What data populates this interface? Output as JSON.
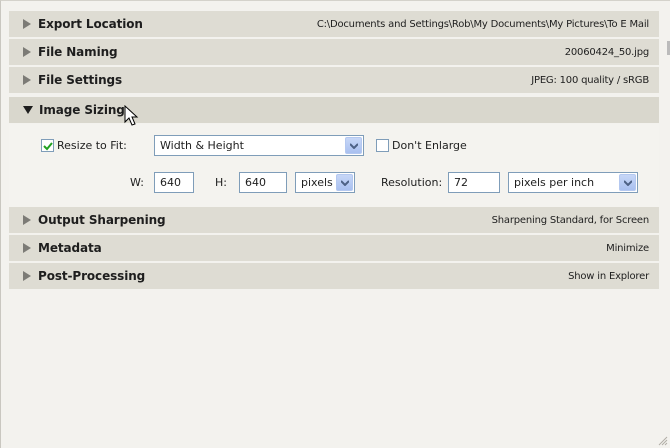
{
  "sections": [
    {
      "title": "Export Location",
      "summary": "C:\\Documents and Settings\\Rob\\My Documents\\My Pictures\\To E Mail"
    },
    {
      "title": "File Naming",
      "summary": "20060424_50.jpg"
    },
    {
      "title": "File Settings",
      "summary": "JPEG: 100 quality / sRGB"
    },
    {
      "title": "Image Sizing",
      "summary": ""
    },
    {
      "title": "Output Sharpening",
      "summary": "Sharpening Standard, for Screen"
    },
    {
      "title": "Metadata",
      "summary": "Minimize"
    },
    {
      "title": "Post-Processing",
      "summary": "Show in Explorer"
    }
  ],
  "image_sizing": {
    "resize_to_fit_label": "Resize to Fit:",
    "resize_to_fit_checked": true,
    "fit_mode": "Width & Height",
    "dont_enlarge_label": "Don't Enlarge",
    "dont_enlarge_checked": false,
    "w_label": "W:",
    "w_value": "640",
    "h_label": "H:",
    "h_value": "640",
    "unit": "pixels",
    "resolution_label": "Resolution:",
    "resolution_value": "72",
    "resolution_unit": "pixels per inch"
  },
  "colors": {
    "header_bg": "#dedcd3",
    "panel_bg": "#f3f2ee",
    "field_border": "#7f9db9",
    "check_green": "#21a121"
  }
}
